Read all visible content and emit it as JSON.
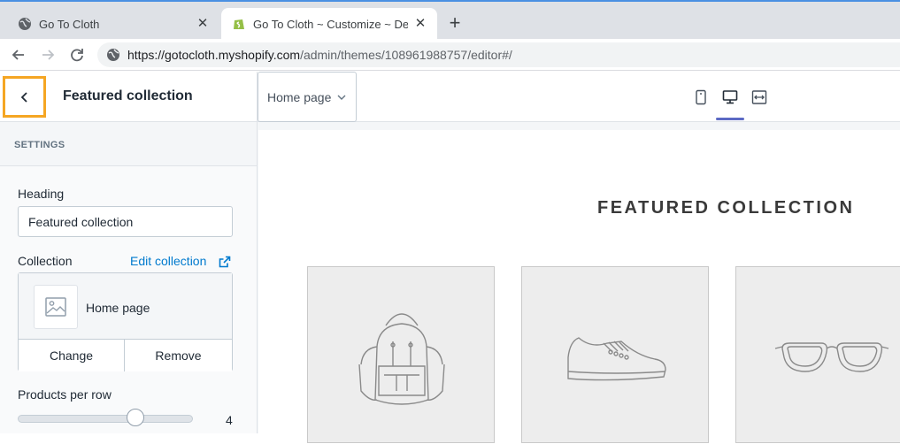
{
  "browser": {
    "tabs": [
      {
        "title": "Go To Cloth",
        "close": "✕"
      },
      {
        "title": "Go To Cloth ~ Customize ~ Debut",
        "close": "✕"
      }
    ],
    "new_tab": "+",
    "url_host": "https://gotocloth.myshopify.com",
    "url_path": "/admin/themes/108961988757/editor#/"
  },
  "editor": {
    "sidebar_title": "Featured collection",
    "page_selector": "Home page",
    "active_view": "desktop"
  },
  "sidebar": {
    "section_label": "SETTINGS",
    "heading_label": "Heading",
    "heading_value": "Featured collection",
    "collection_label": "Collection",
    "edit_collection": "Edit collection",
    "collection_name": "Home page",
    "change_label": "Change",
    "remove_label": "Remove",
    "products_per_row_label": "Products per row",
    "products_per_row_value": "4",
    "products_per_row_fraction": 0.67
  },
  "preview": {
    "title": "FEATURED COLLECTION",
    "products": [
      {
        "icon": "backpack-icon"
      },
      {
        "icon": "sneaker-icon"
      },
      {
        "icon": "sunglasses-icon"
      }
    ]
  },
  "colors": {
    "accent": "#5c6ac4",
    "link": "#007ace",
    "highlight": "#f5a623"
  }
}
